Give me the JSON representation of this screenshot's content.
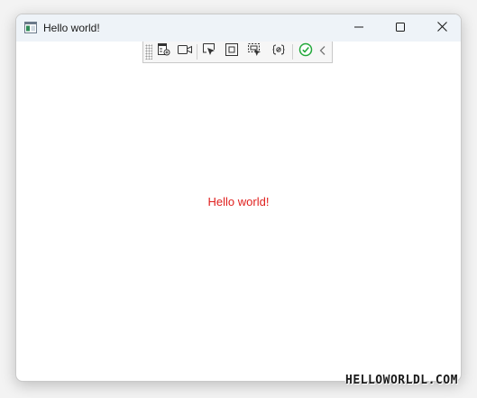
{
  "window": {
    "title": "Hello world!",
    "icon": "app-window-icon",
    "controls": [
      "minimize-icon",
      "maximize-icon",
      "close-icon"
    ]
  },
  "debug_toolbar": {
    "items": [
      {
        "name": "live-visual-tree-icon"
      },
      {
        "name": "record-video-icon"
      },
      {
        "name": "select-element-icon"
      },
      {
        "name": "display-layout-adorners-icon"
      },
      {
        "name": "track-focused-element-icon"
      },
      {
        "name": "binding-failures-icon"
      },
      {
        "name": "hot-reload-status-icon"
      },
      {
        "name": "collapse-toolbar-icon"
      }
    ],
    "status_color": "#22a83a"
  },
  "content": {
    "message": "Hello world!",
    "message_color": "#e0201e"
  },
  "watermark": "HELLOWORLDL.COM"
}
